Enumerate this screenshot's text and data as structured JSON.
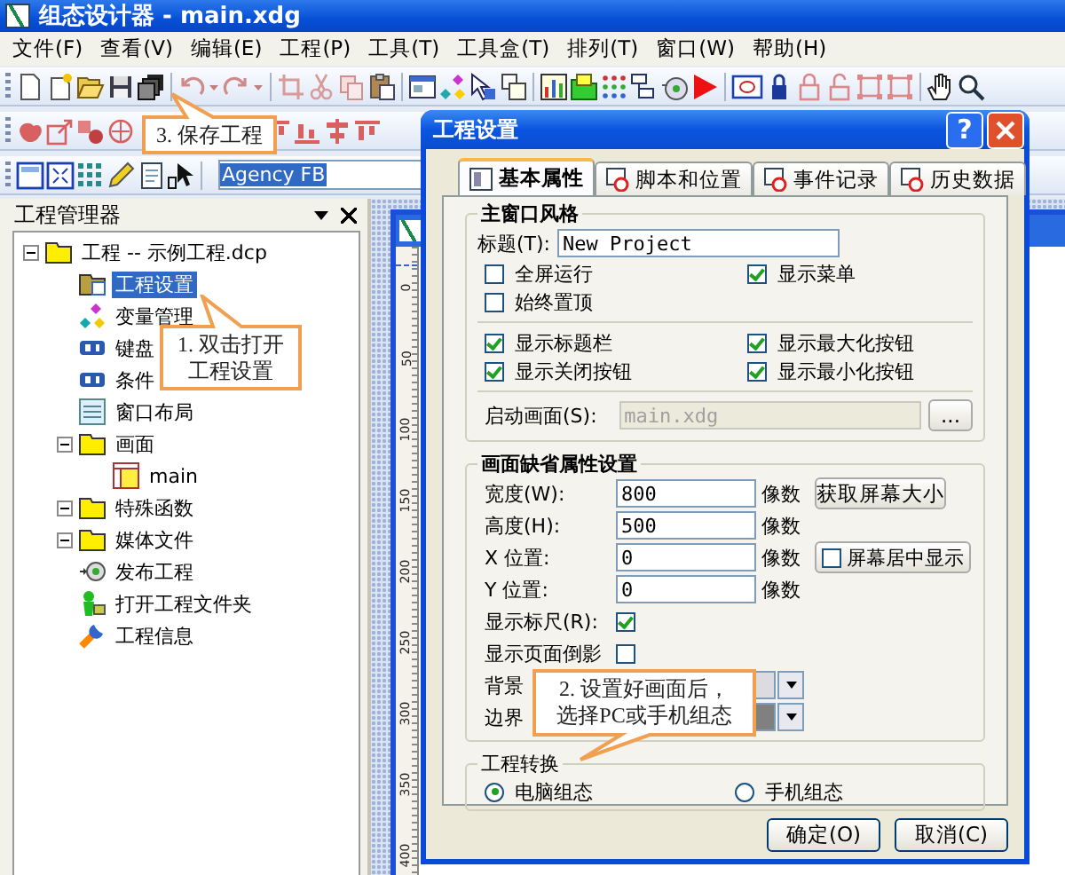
{
  "window": {
    "title": "组态设计器 - main.xdg"
  },
  "menu": [
    "文件(F)",
    "查看(V)",
    "编辑(E)",
    "工程(P)",
    "工具(T)",
    "工具盒(T)",
    "排列(T)",
    "窗口(W)",
    "帮助(H)"
  ],
  "font_field": {
    "value": "Agency FB"
  },
  "project_manager": {
    "title": "工程管理器",
    "tree": [
      {
        "label": "工程 -- 示例工程.dcp",
        "kind": "folder",
        "expanded": true,
        "selected": false,
        "children": [
          {
            "label": "工程设置",
            "kind": "settings",
            "selected": true
          },
          {
            "label": "变量管理",
            "kind": "variables",
            "selected": false
          },
          {
            "label": "键盘",
            "kind": "keyboard",
            "selected": false
          },
          {
            "label": "条件",
            "kind": "keyboard",
            "selected": false
          },
          {
            "label": "窗口布局",
            "kind": "layout",
            "selected": false
          },
          {
            "label": "画面",
            "kind": "folder",
            "expanded": true,
            "selected": false,
            "children": [
              {
                "label": "main",
                "kind": "screen",
                "selected": false
              }
            ]
          },
          {
            "label": "特殊函数",
            "kind": "folder",
            "expanded": true,
            "selected": false
          },
          {
            "label": "媒体文件",
            "kind": "folder",
            "expanded": true,
            "selected": false
          },
          {
            "label": "发布工程",
            "kind": "publish",
            "selected": false
          },
          {
            "label": "打开工程文件夹",
            "kind": "open",
            "selected": false
          },
          {
            "label": "工程信息",
            "kind": "info",
            "selected": false
          }
        ]
      }
    ]
  },
  "canvas": {
    "ruler_labels": [
      "0",
      "50",
      "100",
      "150",
      "200",
      "250",
      "300",
      "350",
      "400"
    ]
  },
  "dialog": {
    "title": "工程设置",
    "help_button": "?",
    "tabs": [
      {
        "label": "基本属性",
        "selected": true
      },
      {
        "label": "脚本和位置",
        "selected": false
      },
      {
        "label": "事件记录",
        "selected": false
      },
      {
        "label": "历史数据",
        "selected": false
      }
    ],
    "main_window_style": {
      "heading": "主窗口风格",
      "title_label": "标题(T):",
      "title_value": "New Project",
      "options": [
        {
          "label": "全屏运行",
          "checked": false
        },
        {
          "label": "显示菜单",
          "checked": true
        },
        {
          "label": "始终置顶",
          "checked": false
        }
      ],
      "options2": [
        {
          "label": "显示标题栏",
          "checked": true
        },
        {
          "label": "显示最大化按钮",
          "checked": true
        },
        {
          "label": "显示关闭按钮",
          "checked": true
        },
        {
          "label": "显示最小化按钮",
          "checked": true
        }
      ],
      "startup": {
        "label": "启动画面(S):",
        "value": "main.xdg",
        "disabled": true,
        "button": "..."
      }
    },
    "screen_defaults": {
      "heading": "画面缺省属性设置",
      "fields": [
        {
          "label": "宽度(W):",
          "value": "800",
          "unit": "像数"
        },
        {
          "label": "高度(H):",
          "value": "500",
          "unit": "像数"
        },
        {
          "label": "X 位置:",
          "value": "0",
          "unit": "像数"
        },
        {
          "label": "Y 位置:",
          "value": "0",
          "unit": "像数"
        }
      ],
      "screen_size_button": "获取屏幕大小",
      "center_option": {
        "label": "屏幕居中显示",
        "checked": false
      },
      "ruler": {
        "label": "显示标尺(R):",
        "checked": true
      },
      "shadow": {
        "label": "显示页面倒影",
        "checked": false
      },
      "colors": [
        {
          "label": "背景",
          "color": "#dcdce0"
        },
        {
          "label": "边界",
          "color": "#808080"
        }
      ]
    },
    "conversion": {
      "heading": "工程转换",
      "options": [
        {
          "label": "电脑组态",
          "selected": true
        },
        {
          "label": "手机组态",
          "selected": false
        }
      ]
    },
    "buttons": [
      "确定(O)",
      "取消(C)"
    ]
  },
  "callouts": [
    {
      "lines": [
        "3. 保存工程"
      ]
    },
    {
      "lines": [
        "1. 双击打开",
        "工程设置"
      ]
    },
    {
      "lines": [
        "2. 设置好画面后，",
        "选择PC或手机组态"
      ]
    }
  ]
}
